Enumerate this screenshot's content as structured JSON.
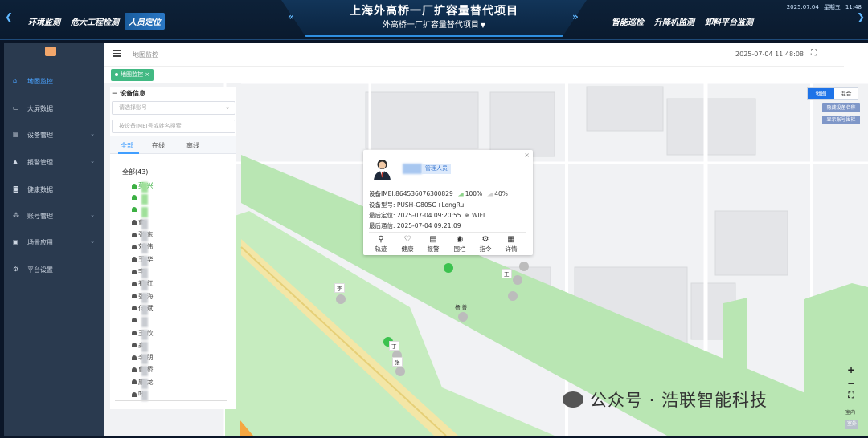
{
  "header": {
    "title": "上海外高桥一厂扩容量替代项目",
    "subtitle": "外高桥一厂扩容量替代项目",
    "left_nav": [
      "环境监测",
      "危大工程检测",
      "人员定位"
    ],
    "right_nav": [
      "智能巡检",
      "升降机监测",
      "卸料平台监测"
    ],
    "date": "2025.07.04",
    "weekday": "星期五",
    "clock": "11:48",
    "active_nav": "人员定位"
  },
  "sidebar": {
    "items": [
      {
        "label": "地图监控",
        "icon": "home-icon"
      },
      {
        "label": "大屏数据",
        "icon": "screen-icon"
      },
      {
        "label": "设备管理",
        "icon": "device-icon"
      },
      {
        "label": "报警管理",
        "icon": "alarm-icon"
      },
      {
        "label": "健康数据",
        "icon": "camera-icon"
      },
      {
        "label": "账号管理",
        "icon": "account-icon"
      },
      {
        "label": "场景应用",
        "icon": "scene-icon"
      },
      {
        "label": "平台设置",
        "icon": "gear-icon"
      }
    ]
  },
  "content_header": {
    "breadcrumb": "地图监控",
    "datetime": "2025-07-04 11:48:08",
    "tab": "地图监控"
  },
  "device_panel": {
    "title": "设备信息",
    "account_placeholder": "请选择账号",
    "search_placeholder": "按设备IMEI号或姓名搜索",
    "tabs": [
      "全部",
      "在线",
      "离线"
    ],
    "tree_root": "全部(43)",
    "people": [
      "莫 兴",
      "",
      "",
      "曹",
      "张 东",
      "刘 伟",
      "王 华",
      "李",
      "祁 红",
      "张 海",
      "何 斌",
      "",
      "王 欣",
      "高",
      "李 朋",
      "曹 桥",
      "康 龙",
      "叶"
    ]
  },
  "map_controls": {
    "map_label": "地图",
    "hybrid_label": "混合",
    "hide_name_label": "隐藏设备名称",
    "show_fence_label": "显示账号围栏",
    "zoom_in": "+",
    "zoom_out": "−",
    "fullscreen": "⛶",
    "indoor_label": "室内",
    "outdoor_label": "室外"
  },
  "popup": {
    "role": "管理人员",
    "imei": "设备IMEI:864536076300829",
    "battery": "100%",
    "signal": "40%",
    "model": "设备型号: PUSH-G805G+LongRu",
    "last_location": "最后定位: 2025-07-04 09:20:55",
    "wifi": "WIFI",
    "last_comm": "最后通信: 2025-07-04 09:21:09",
    "actions": [
      "轨迹",
      "健康",
      "报警",
      "围栏",
      "指令",
      "详情"
    ]
  },
  "markers": [
    "李",
    "王",
    "杨 善",
    "丁",
    "张"
  ],
  "watermark": "公众号 · 浩联智能科技",
  "colors": {
    "accent": "#409eff",
    "online": "#3cc24f",
    "offline": "#bcbcbc",
    "header_bg": "#0d2138"
  }
}
